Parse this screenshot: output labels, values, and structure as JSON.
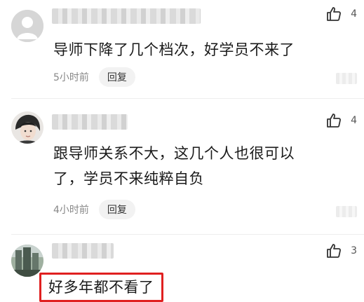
{
  "comments": [
    {
      "text_lines": [
        "导师下降了几个档次，好学员不来了"
      ],
      "time": "5小时前",
      "reply_label": "回复",
      "likes": "4",
      "avatar": "default-user-icon"
    },
    {
      "text_lines": [
        "跟导师关系不大，这几个人也很可以",
        "了，学员不来纯粹自负"
      ],
      "time": "4小时前",
      "reply_label": "回复",
      "likes": "4",
      "avatar": "person-avatar"
    },
    {
      "text_lines": [
        "好多年都不看了"
      ],
      "likes": "3",
      "avatar": "building-avatar",
      "highlighted": true
    }
  ],
  "colors": {
    "highlight_border": "#e02020",
    "reply_bg": "#f2f2f2",
    "time_text": "#888888"
  },
  "icons": {
    "like": "thumbs-up-icon"
  }
}
